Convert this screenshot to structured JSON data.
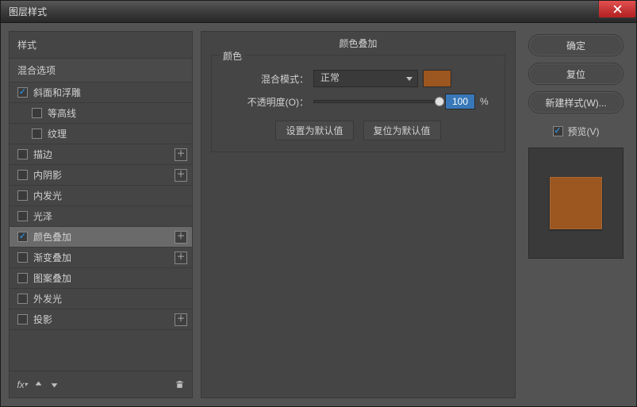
{
  "title": "图层样式",
  "styles_panel": {
    "header": "样式",
    "subheader": "混合选项",
    "items": [
      {
        "label": "斜面和浮雕",
        "checked": true,
        "indent": false,
        "has_add": false
      },
      {
        "label": "等高线",
        "checked": false,
        "indent": true,
        "has_add": false
      },
      {
        "label": "纹理",
        "checked": false,
        "indent": true,
        "has_add": false
      },
      {
        "label": "描边",
        "checked": false,
        "indent": false,
        "has_add": true
      },
      {
        "label": "内阴影",
        "checked": false,
        "indent": false,
        "has_add": true
      },
      {
        "label": "内发光",
        "checked": false,
        "indent": false,
        "has_add": false
      },
      {
        "label": "光泽",
        "checked": false,
        "indent": false,
        "has_add": false
      },
      {
        "label": "颜色叠加",
        "checked": true,
        "indent": false,
        "has_add": true,
        "selected": true
      },
      {
        "label": "渐变叠加",
        "checked": false,
        "indent": false,
        "has_add": true
      },
      {
        "label": "图案叠加",
        "checked": false,
        "indent": false,
        "has_add": false
      },
      {
        "label": "外发光",
        "checked": false,
        "indent": false,
        "has_add": false
      },
      {
        "label": "投影",
        "checked": false,
        "indent": false,
        "has_add": true
      }
    ]
  },
  "main_panel": {
    "section_title": "颜色叠加",
    "group_title": "颜色",
    "blend_label": "混合模式：",
    "blend_value": "正常",
    "opacity_label": "不透明度(O)：",
    "opacity_value": "100",
    "opacity_suffix": "%",
    "swatch_color": "#9c561f",
    "btn_default": "设置为默认值",
    "btn_reset": "复位为默认值"
  },
  "right_panel": {
    "ok": "确定",
    "cancel": "复位",
    "new_style": "新建样式(W)...",
    "preview_label": "预览(V)",
    "preview_checked": true,
    "preview_color": "#9c561f"
  }
}
